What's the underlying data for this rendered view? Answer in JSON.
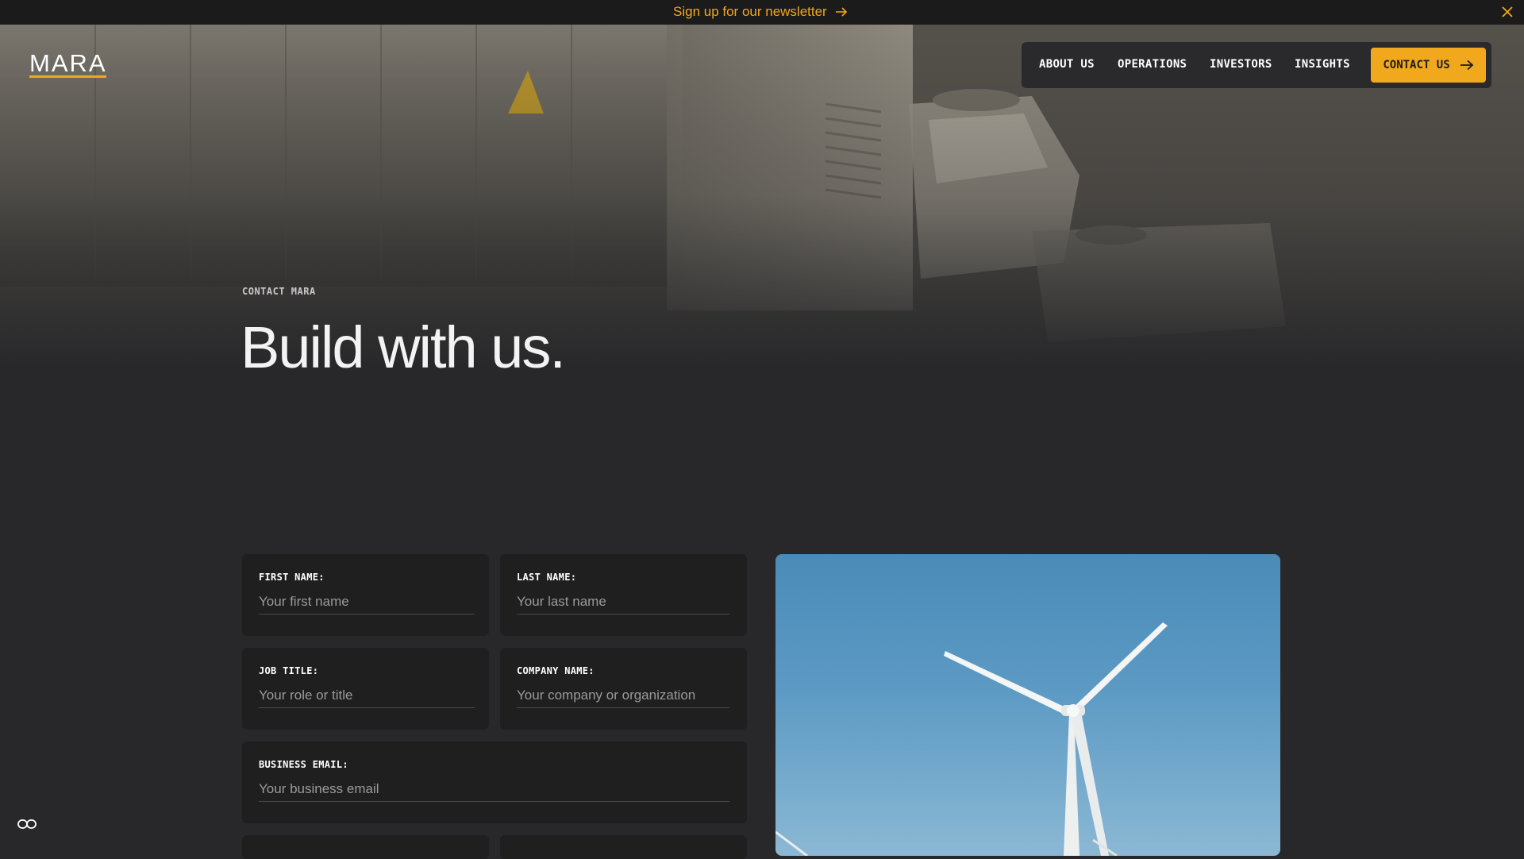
{
  "announcement": {
    "text": "Sign up for our newsletter",
    "arrow_icon": "arrow-right-icon",
    "close_icon": "close-icon"
  },
  "header": {
    "logo": "MARA",
    "nav": [
      {
        "label": "ABOUT US"
      },
      {
        "label": "OPERATIONS"
      },
      {
        "label": "INVESTORS"
      },
      {
        "label": "INSIGHTS"
      }
    ],
    "cta_label": "CONTACT US"
  },
  "hero": {
    "eyebrow": "CONTACT MARA",
    "title": "Build with us."
  },
  "form": {
    "first_name": {
      "label": "FIRST NAME:",
      "placeholder": "Your first name",
      "value": ""
    },
    "last_name": {
      "label": "LAST NAME:",
      "placeholder": "Your last name",
      "value": ""
    },
    "job_title": {
      "label": "JOB TITLE:",
      "placeholder": "Your role or title",
      "value": ""
    },
    "company_name": {
      "label": "COMPANY NAME:",
      "placeholder": "Your company or organization",
      "value": ""
    },
    "business_email": {
      "label": "BUSINESS EMAIL:",
      "placeholder": "Your business email",
      "value": ""
    }
  },
  "colors": {
    "accent": "#f2a81d",
    "background": "#28282a",
    "card": "#1f1f20"
  },
  "icons": {
    "accessibility": "accessibility-toggle-icon"
  }
}
